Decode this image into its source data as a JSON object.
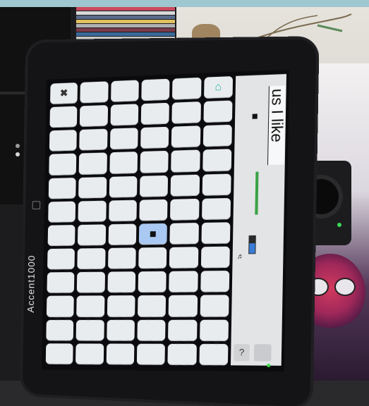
{
  "scene": {
    "description_label": "photo"
  },
  "device": {
    "brand": "Accent1000",
    "message_text": "us I like",
    "help_glyph": "?",
    "status_text": "",
    "grid": {
      "rows": 12,
      "cols": 6
    }
  },
  "icons": {
    "delete": "delete-icon",
    "home": "home-icon",
    "stop": "stop-icon",
    "help": "help-icon",
    "settings": "gear-icon",
    "volume": "volume-icon",
    "battery": "battery-icon"
  },
  "colors": {
    "key": "#e9ecef",
    "key_selected": "#a9c9f2",
    "accent_home": "#2bb3a4",
    "indicator_green": "#3ba245"
  }
}
